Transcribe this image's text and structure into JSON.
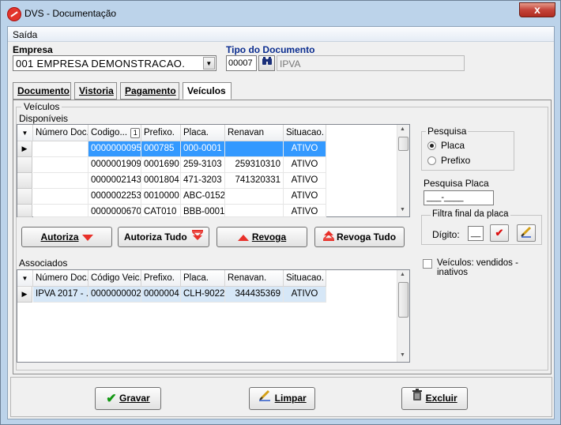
{
  "window": {
    "title": "DVS - Documentação",
    "close_glyph": "x"
  },
  "menu": {
    "items": [
      {
        "label": "Saída"
      }
    ]
  },
  "empresa": {
    "label": "Empresa",
    "value": "001 EMPRESA DEMONSTRACAO."
  },
  "tipo_documento": {
    "label": "Tipo do Documento",
    "code": "00007",
    "description": "IPVA"
  },
  "tabs": [
    {
      "label": "Documento",
      "active": false
    },
    {
      "label": "Vistoria",
      "active": false
    },
    {
      "label": "Pagamento",
      "active": false
    },
    {
      "label": "Veículos",
      "active": true
    }
  ],
  "veiculos_group": {
    "title": "Veículos",
    "disponiveis_label": "Disponíveis",
    "associados_label": "Associados"
  },
  "disponiveis": {
    "columns": [
      "Número Doc.",
      "Codigo...",
      "Prefixo.",
      "Placa.",
      "Renavan",
      "Situacao."
    ],
    "sort_badge": "1",
    "rows": [
      {
        "numero": "",
        "codigo": "0000000095",
        "prefixo": "000785",
        "placa": "000-0001",
        "renavan": "",
        "situacao": "ATIVO"
      },
      {
        "numero": "",
        "codigo": "0000001909",
        "prefixo": "0001690",
        "placa": "259-3103",
        "renavan": "259310310",
        "situacao": "ATIVO"
      },
      {
        "numero": "",
        "codigo": "0000002143",
        "prefixo": "0001804",
        "placa": "471-3203",
        "renavan": "741320331",
        "situacao": "ATIVO"
      },
      {
        "numero": "",
        "codigo": "0000002253",
        "prefixo": "0010000",
        "placa": "ABC-0152",
        "renavan": "",
        "situacao": "ATIVO"
      },
      {
        "numero": "",
        "codigo": "0000000670",
        "prefixo": "CAT010",
        "placa": "BBB-0001",
        "renavan": "",
        "situacao": "ATIVO"
      }
    ]
  },
  "actions": {
    "autoriza": "Autoriza",
    "autoriza_tudo": "Autoriza Tudo",
    "revoga": "Revoga",
    "revoga_tudo": "Revoga Tudo"
  },
  "associados": {
    "columns": [
      "Número Doc.",
      "Código Veic.",
      "Prefixo.",
      "Placa.",
      "Renavan.",
      "Situacao."
    ],
    "rows": [
      {
        "numero": "IPVA 2017 - ...",
        "codigo": "0000000002",
        "prefixo": "0000004",
        "placa": "CLH-9022",
        "renavan": "344435369",
        "situacao": "ATIVO"
      }
    ]
  },
  "pesquisa": {
    "title": "Pesquisa",
    "options": [
      {
        "label": "Placa",
        "checked": true
      },
      {
        "label": "Prefixo",
        "checked": false
      }
    ]
  },
  "pesquisa_placa": {
    "label": "Pesquisa Placa",
    "mask": "___-____"
  },
  "filtra": {
    "title": "Filtra final da placa",
    "digito_label": "Dígito:",
    "digito_value": "__"
  },
  "veiculos_vendidos": {
    "label": "Veículos: vendidos - inativos",
    "checked": false
  },
  "footer": {
    "gravar": "Gravar",
    "limpar": "Limpar",
    "excluir": "Excluir"
  },
  "colors": {
    "titlebar": "#bcd3ea",
    "selection": "#3399ff",
    "label_blue": "#0b2d8f",
    "accent_red": "#e8312a"
  }
}
